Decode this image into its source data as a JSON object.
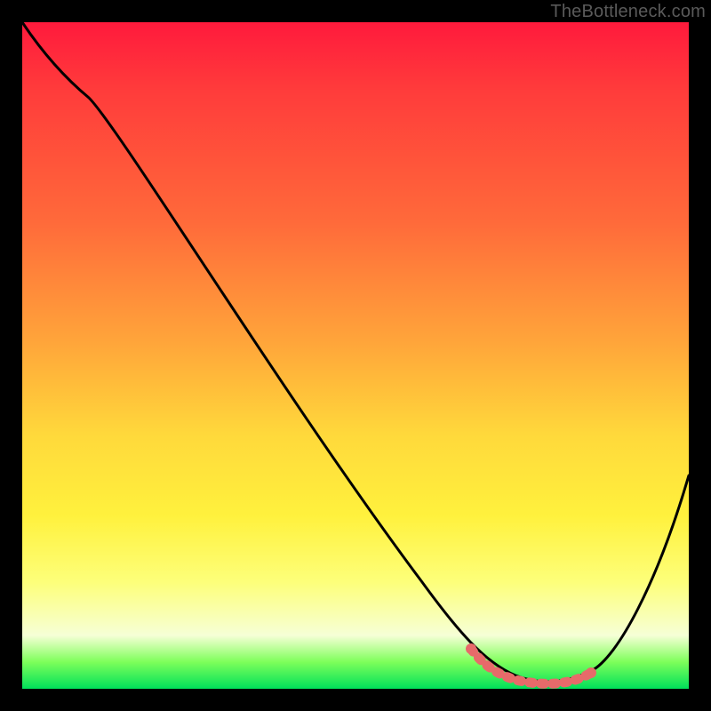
{
  "watermark": "TheBottleneck.com",
  "chart_data": {
    "type": "line",
    "title": "",
    "xlabel": "",
    "ylabel": "",
    "xlim": [
      0,
      100
    ],
    "ylim": [
      0,
      100
    ],
    "grid": false,
    "legend": false,
    "series": [
      {
        "name": "bottleneck-curve",
        "color": "#000000",
        "x": [
          0,
          5,
          10,
          20,
          30,
          40,
          50,
          60,
          68,
          72,
          76,
          80,
          84,
          90,
          100
        ],
        "y": [
          100,
          96,
          91,
          80,
          68,
          56,
          44,
          32,
          17,
          7,
          2,
          1,
          2,
          11,
          33
        ]
      },
      {
        "name": "optimal-range-highlight",
        "color": "#e76a6a",
        "x": [
          68,
          72,
          76,
          80,
          84
        ],
        "y": [
          5,
          2.5,
          1.5,
          1.5,
          2.5
        ]
      }
    ],
    "background_gradient": [
      "#ff1a3c",
      "#ff6a3a",
      "#ffd93b",
      "#fdff7a",
      "#00e05a"
    ]
  }
}
